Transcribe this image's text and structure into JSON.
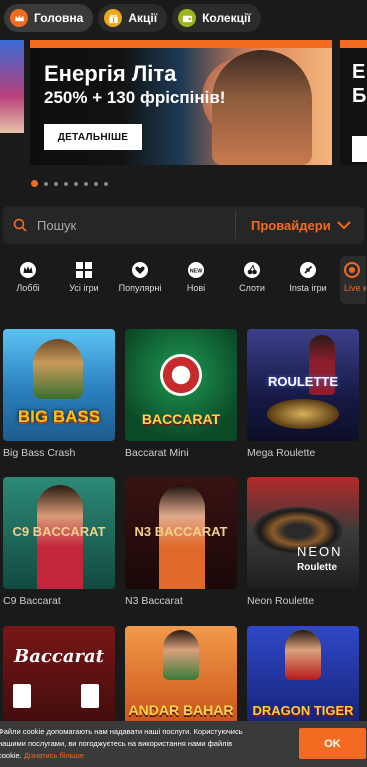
{
  "top_tabs": [
    {
      "label": "Головна",
      "icon": "crown-icon",
      "icon_bg": "#f26b21",
      "active": true
    },
    {
      "label": "Акції",
      "icon": "gift-icon",
      "icon_bg": "#e9a91b",
      "active": false
    },
    {
      "label": "Колекції",
      "icon": "wallet-icon",
      "icon_bg": "#9fb51c",
      "active": false
    }
  ],
  "banner": {
    "title": "Енергія Літа",
    "subtitle": "250% + 130 фріспінів!",
    "button": "ДЕТАЛЬНІШЕ",
    "next_title": "Е\nБ"
  },
  "carousel": {
    "count": 8,
    "active": 0
  },
  "search": {
    "placeholder": "Пошук",
    "providers_label": "Провайдери"
  },
  "categories": [
    {
      "label": "Лоббі",
      "icon": "crown-icon"
    },
    {
      "label": "Усі ігри",
      "icon": "grid-icon"
    },
    {
      "label": "Популярні",
      "icon": "heart-icon"
    },
    {
      "label": "Нові",
      "icon": "new-badge-icon"
    },
    {
      "label": "Слоти",
      "icon": "cherry-icon"
    },
    {
      "label": "Insta ігри",
      "icon": "rocket-icon"
    },
    {
      "label": "Live к",
      "icon": "live-icon"
    }
  ],
  "games": [
    {
      "name": "Big Bass Crash",
      "logo": "BIG BASS",
      "colors": [
        "#3aa0df",
        "#2e6fa0"
      ]
    },
    {
      "name": "Baccarat Mini",
      "logo": "BACCARAT",
      "colors": [
        "#0f6b3a",
        "#0a3f23"
      ]
    },
    {
      "name": "Mega Roulette",
      "logo": "ROULETTE",
      "colors": [
        "#2b2f6e",
        "#12153a"
      ]
    },
    {
      "name": "C9 Baccarat",
      "logo": "C9 BACCARAT",
      "colors": [
        "#1b6b5c",
        "#0e3a33"
      ]
    },
    {
      "name": "N3 Baccarat",
      "logo": "N3 BACCARAT",
      "colors": [
        "#5a1e1e",
        "#2a0d0d"
      ]
    },
    {
      "name": "Neon Roulette",
      "logo": "NEON",
      "colors": [
        "#7a1e1e",
        "#2a2a2a"
      ]
    },
    {
      "name": "",
      "logo": "Baccarat",
      "colors": [
        "#8a1f1f",
        "#4a1010"
      ]
    },
    {
      "name": "",
      "logo": "ANDAR BAHAR",
      "colors": [
        "#e9823a",
        "#c04a1a"
      ]
    },
    {
      "name": "",
      "logo": "DRAGON TIGER",
      "colors": [
        "#2a3fb8",
        "#121e6e"
      ]
    }
  ],
  "cookie": {
    "text_line1": "Файли cookie допомагають нам надавати наші послуги. Користуючись",
    "text_line2": "нашими послугами, ви погоджуєтесь на використання нами файлів",
    "text_prefix": "cookie.",
    "link": "Дізнатись більше",
    "ok": "OK"
  },
  "accent_color": "#f26b21"
}
